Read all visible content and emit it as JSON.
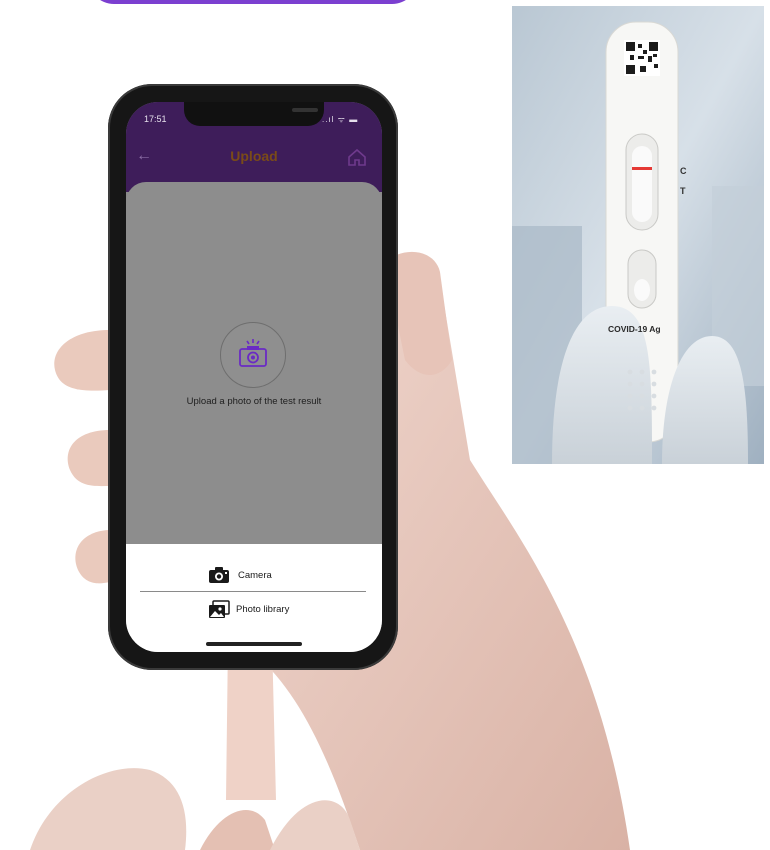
{
  "status_bar": {
    "time": "17:51",
    "signal": "..ıl ᯤ ▬"
  },
  "header": {
    "title": "Upload",
    "back_icon": "arrow-left-icon",
    "home_icon": "home-icon"
  },
  "main": {
    "upload_text": "Upload a photo of the test result",
    "upload_icon": "camera-upload-icon"
  },
  "sheet": {
    "camera_label": "Camera",
    "library_label": "Photo library"
  },
  "test_photo": {
    "marker_c": "C",
    "marker_t": "T",
    "cassette_label": "COVID-19 Ag"
  },
  "colors": {
    "accent": "#7b3fd0",
    "appbar": "#3e1d5a",
    "title": "#7a4b18",
    "test_line": "#e53935"
  }
}
